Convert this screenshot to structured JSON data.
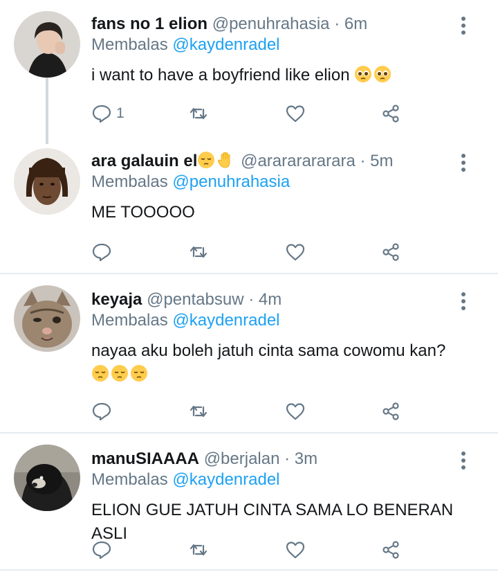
{
  "tweets": [
    {
      "name": "fans no 1 elion",
      "handle": "@penuhrahasia",
      "time": "6m",
      "reply_prefix": "Membalas",
      "reply_to": "@kaydenradel",
      "text": "i want to have a boyfriend like elion",
      "emojis": [
        "pleading-face",
        "pleading-face"
      ],
      "reply_count": "1",
      "avatar": "person-avatar"
    },
    {
      "name": "ara galauin el",
      "name_emojis": [
        "pensive-face",
        "raised-hand"
      ],
      "handle": "@arararararara",
      "time": "5m",
      "reply_prefix": "Membalas",
      "reply_to": "@penuhrahasia",
      "text": "ME TOOOOO",
      "avatar": "person-avatar"
    },
    {
      "name": "keyaja",
      "handle": "@pentabsuw",
      "time": "4m",
      "reply_prefix": "Membalas",
      "reply_to": "@kaydenradel",
      "text": "nayaa aku boleh jatuh cinta sama cowomu kan?",
      "emojis": [
        "pensive-face",
        "pensive-face",
        "pensive-face"
      ],
      "avatar": "cat-avatar"
    },
    {
      "name": "manuSIAAAA",
      "handle": "@berjalan",
      "time": "3m",
      "reply_prefix": "Membalas",
      "reply_to": "@kaydenradel",
      "text": "ELION GUE JATUH CINTA SAMA LO BENERAN ASLI",
      "avatar": "masked-dog-avatar"
    }
  ],
  "separator": "·",
  "colors": {
    "link": "#1da1f2",
    "muted": "#657786",
    "text": "#14171a",
    "divider": "#e6ecf0"
  }
}
